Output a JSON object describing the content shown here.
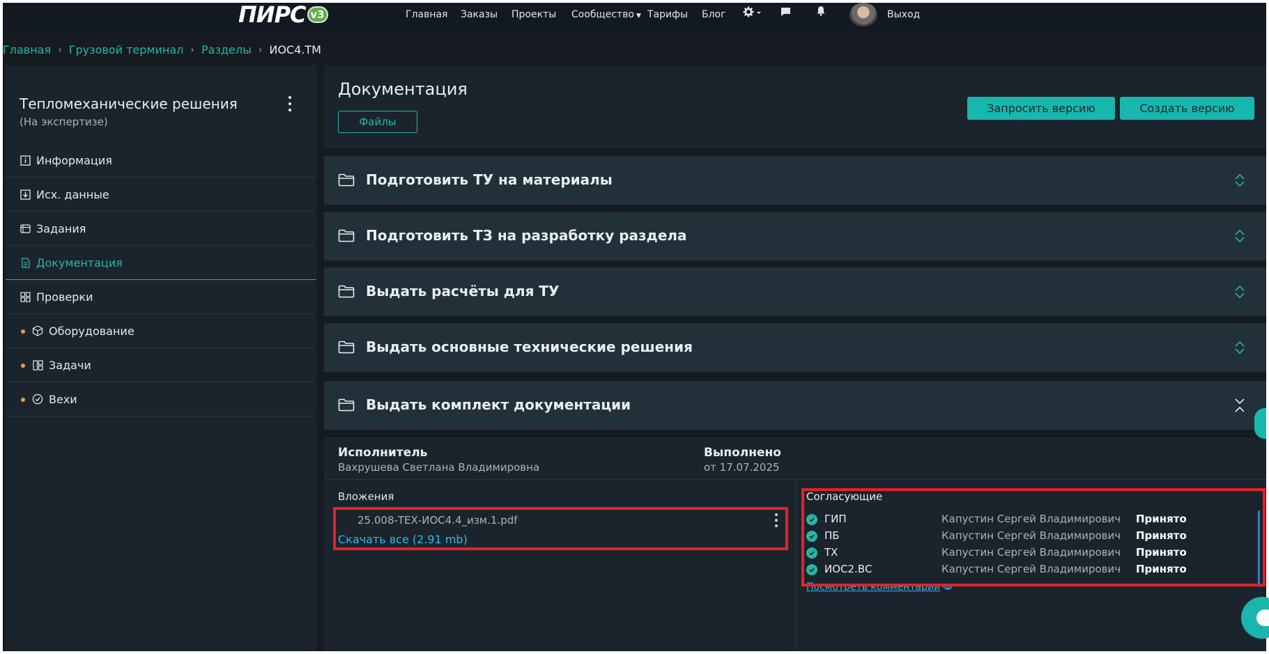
{
  "logo": {
    "text": "ПИРС",
    "badge": "v3"
  },
  "nav": {
    "items": [
      "Главная",
      "Заказы",
      "Проекты",
      "Сообщество",
      "Тарифы",
      "Блог"
    ],
    "logout": "Выход",
    "icons": [
      "gear-icon",
      "chat-icon",
      "bell-icon"
    ]
  },
  "breadcrumb": {
    "items": [
      "Главная",
      "Грузовой терминал",
      "Разделы"
    ],
    "current": "ИОС4.ТМ"
  },
  "sidebar": {
    "title": "Тепломеханические решения",
    "subtitle": "(На экспертизе)",
    "items": [
      {
        "label": "Информация",
        "icon": "info-icon"
      },
      {
        "label": "Исх. данные",
        "icon": "download-icon"
      },
      {
        "label": "Задания",
        "icon": "tasks-icon"
      },
      {
        "label": "Документация",
        "icon": "document-icon",
        "active": true
      },
      {
        "label": "Проверки",
        "icon": "grid-icon"
      },
      {
        "label": "Оборудование",
        "icon": "box-icon"
      },
      {
        "label": "Задачи",
        "icon": "board-icon"
      },
      {
        "label": "Вехи",
        "icon": "check-circle-icon"
      }
    ]
  },
  "main": {
    "title": "Документация",
    "files_button": "Файлы",
    "request_version_button": "Запросить версию",
    "create_version_button": "Создать версию"
  },
  "accordion": [
    {
      "title": "Подготовить ТУ на материалы",
      "expanded": false
    },
    {
      "title": "Подготовить ТЗ на разработку раздела",
      "expanded": false
    },
    {
      "title": "Выдать расчёты для ТУ",
      "expanded": false
    },
    {
      "title": "Выдать основные технические решения",
      "expanded": false
    },
    {
      "title": "Выдать комплект документации",
      "expanded": true
    }
  ],
  "detail": {
    "executor_label": "Исполнитель",
    "executor_name": "Вахрушева Светлана Владимировна",
    "done_label": "Выполнено",
    "done_date": "от 17.07.2025",
    "attachments_label": "Вложения",
    "file_name": "25.008-ТЕХ-ИОС4.4_изм.1.pdf",
    "download_all": "Скачать все (2.91 mb)",
    "approvers_label": "Согласующие",
    "approvers": [
      {
        "role": "ГИП",
        "person": "Капустин Сергей Владимирович",
        "status": "Принято"
      },
      {
        "role": "ПБ",
        "person": "Капустин Сергей Владимирович",
        "status": "Принято"
      },
      {
        "role": "ТХ",
        "person": "Капустин Сергей Владимирович",
        "status": "Принято"
      },
      {
        "role": "ИОС2.ВС",
        "person": "Капустин Сергей Владимирович",
        "status": "Принято"
      }
    ],
    "view_comments": "Посмотреть комментарии"
  },
  "colors": {
    "accent": "#2ab3a6",
    "background": "#151b21",
    "highlight": "#e3222b",
    "link": "#34b6e8"
  }
}
